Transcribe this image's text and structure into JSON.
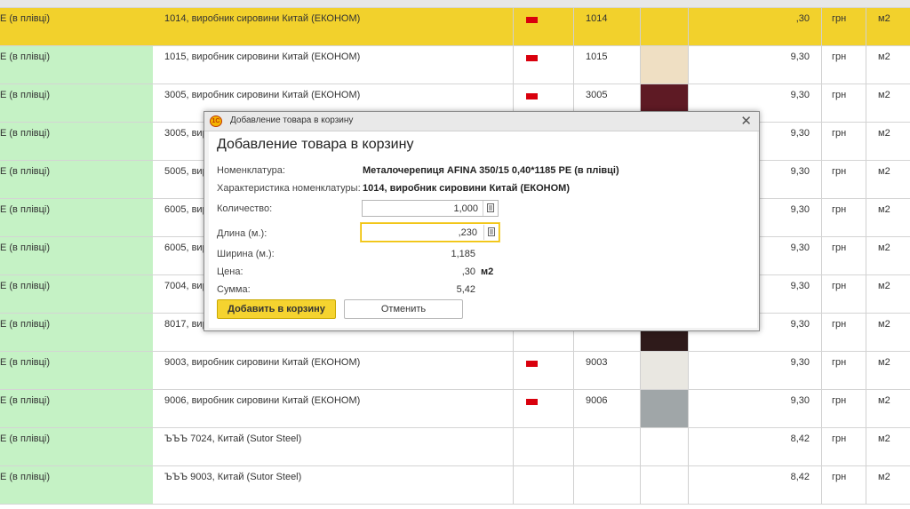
{
  "table": {
    "rows": [
      {
        "product": "Е (в плівці)",
        "characteristic": "1014, виробник сировини Китай (ЕКОНОМ)",
        "code": "1014",
        "swatch": "",
        "price": ",30",
        "currency": "грн",
        "unit": "м2",
        "selected": true
      },
      {
        "product": "Е (в плівці)",
        "characteristic": "1015, виробник сировини Китай (ЕКОНОМ)",
        "code": "1015",
        "swatch": "#efdfc3",
        "price": "9,30",
        "currency": "грн",
        "unit": "м2"
      },
      {
        "product": "Е (в плівці)",
        "characteristic": "3005, виробник сировини Китай (ЕКОНОМ)",
        "code": "3005",
        "swatch": "#5e1a24",
        "price": "9,30",
        "currency": "грн",
        "unit": "м2"
      },
      {
        "product": "Е (в плівці)",
        "characteristic": "3005, вир",
        "code": "",
        "swatch": "",
        "price": "9,30",
        "currency": "грн",
        "unit": "м2"
      },
      {
        "product": "Е (в плівці)",
        "characteristic": "5005, вир",
        "code": "",
        "swatch": "",
        "price": "9,30",
        "currency": "грн",
        "unit": "м2"
      },
      {
        "product": "Е (в плівці)",
        "characteristic": "6005, вир",
        "code": "",
        "swatch": "",
        "price": "9,30",
        "currency": "грн",
        "unit": "м2"
      },
      {
        "product": "Е (в плівці)",
        "characteristic": "6005, вир",
        "code": "",
        "swatch": "",
        "price": "9,30",
        "currency": "грн",
        "unit": "м2"
      },
      {
        "product": "Е (в плівці)",
        "characteristic": "7004, вир",
        "code": "",
        "swatch": "",
        "price": "9,30",
        "currency": "грн",
        "unit": "м2"
      },
      {
        "product": "Е (в плівці)",
        "characteristic": "8017, вир",
        "code": "",
        "swatch": "#2e1a1a",
        "price": "9,30",
        "currency": "грн",
        "unit": "м2"
      },
      {
        "product": "Е (в плівці)",
        "characteristic": "9003, виробник сировини Китай (ЕКОНОМ)",
        "code": "9003",
        "swatch": "#e9e7e1",
        "price": "9,30",
        "currency": "грн",
        "unit": "м2"
      },
      {
        "product": "Е (в плівці)",
        "characteristic": "9006, виробник сировини Китай (ЕКОНОМ)",
        "code": "9006",
        "swatch": "#a0a6a8",
        "price": "9,30",
        "currency": "грн",
        "unit": "м2"
      },
      {
        "product": "Е (в плівці)",
        "characteristic": "ЪЪЪ 7024, Китай (Sutor Steel)",
        "code": "",
        "swatch": "",
        "price": "8,42",
        "currency": "грн",
        "unit": "м2"
      },
      {
        "product": "Е (в плівці)",
        "characteristic": "ЪЪЪ 9003, Китай (Sutor Steel)",
        "code": "",
        "swatch": "",
        "price": "8,42",
        "currency": "грн",
        "unit": "м2"
      }
    ]
  },
  "dialog": {
    "window_title": "Добавление товара в корзину",
    "heading": "Добавление товара в корзину",
    "logo_text": "1С",
    "close_glyph": "✕",
    "nomenclature_label": "Номенклатура:",
    "nomenclature_value": "Металочерепиця AFINA 350/15 0,40*1185 PE (в плівці)",
    "characteristic_label": "Характеристика номенклатуры:",
    "characteristic_value": "1014, виробник сировини Китай (ЕКОНОМ)",
    "quantity_label": "Количество:",
    "quantity_value": "1,000",
    "length_label": "Длина (м.):",
    "length_value": ",230",
    "width_label": "Ширина (м.):",
    "width_value": "1,185",
    "price_label": "Цена:",
    "price_value": ",30",
    "price_unit": "м2",
    "sum_label": "Сумма:",
    "sum_value": "5,42",
    "add_button": "Добавить в корзину",
    "cancel_button": "Отменить"
  },
  "colors": {
    "selected_row": "#f2d12c",
    "product_column": "#c5f2c5",
    "flag": "#d9000d",
    "primary_button": "#f5d32f"
  }
}
